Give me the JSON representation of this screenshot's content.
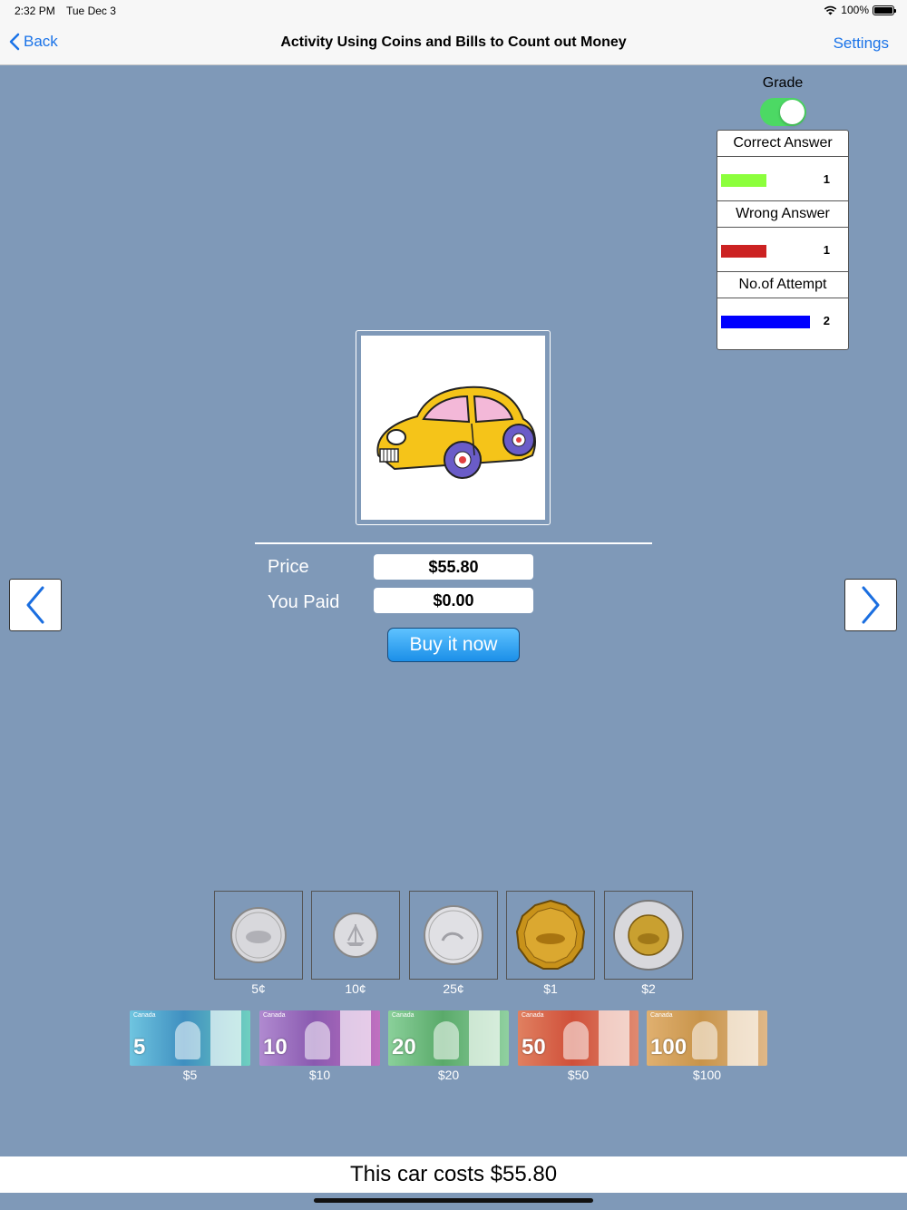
{
  "status": {
    "time": "2:32 PM",
    "date": "Tue Dec 3",
    "battery": "100%"
  },
  "nav": {
    "back": "Back",
    "title": "Activity Using Coins and Bills to Count out Money",
    "settings": "Settings"
  },
  "grade": {
    "label": "Grade",
    "on": true
  },
  "scoreboard": {
    "correct_label": "Correct Answer",
    "correct_value": "1",
    "correct_color": "#8cff3c",
    "wrong_label": "Wrong Answer",
    "wrong_value": "1",
    "wrong_color": "#cc2222",
    "attempt_label": "No.of Attempt",
    "attempt_value": "2",
    "attempt_color": "#0000ff"
  },
  "item": {
    "icon": "car-icon"
  },
  "price": {
    "label": "Price",
    "value": "$55.80"
  },
  "paid": {
    "label": "You Paid",
    "value": "$0.00"
  },
  "buy_button": "Buy it now",
  "coins": [
    {
      "label": "5¢",
      "icon": "nickel-coin"
    },
    {
      "label": "10¢",
      "icon": "dime-coin"
    },
    {
      "label": "25¢",
      "icon": "quarter-coin"
    },
    {
      "label": "$1",
      "icon": "loonie-coin"
    },
    {
      "label": "$2",
      "icon": "toonie-coin"
    }
  ],
  "bills": [
    {
      "label": "$5",
      "num": "5",
      "color": "#4aa3c8"
    },
    {
      "label": "$10",
      "num": "10",
      "color": "#8a5ab0"
    },
    {
      "label": "$20",
      "num": "20",
      "color": "#5aaa6a"
    },
    {
      "label": "$50",
      "num": "50",
      "color": "#d0503a"
    },
    {
      "label": "$100",
      "num": "100",
      "color": "#c8944a"
    }
  ],
  "bill_country": "Canada",
  "message": "This car costs $55.80"
}
